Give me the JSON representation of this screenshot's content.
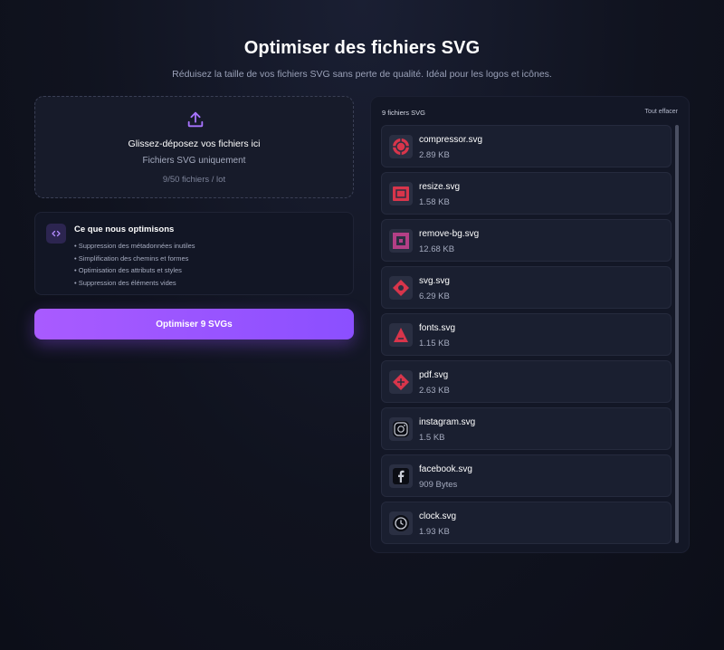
{
  "header": {
    "title": "Optimiser des fichiers SVG",
    "subtitle": "Réduisez la taille de vos fichiers SVG sans perte de qualité. Idéal pour les logos et icônes."
  },
  "dropzone": {
    "icon": "upload-icon",
    "title": "Glissez-déposez vos fichiers ici",
    "subtitle": "Fichiers SVG uniquement",
    "count": "9/50 fichiers / lot"
  },
  "info": {
    "icon": "code-icon",
    "title": "Ce que nous optimisons",
    "items": [
      "• Suppression des métadonnées inutiles",
      "• Simplification des chemins et formes",
      "• Optimisation des attributs et styles",
      "• Suppression des éléments vides"
    ]
  },
  "optimize_button": "Optimiser 9 SVGs",
  "files_panel": {
    "count_label": "9 fichiers SVG",
    "clear_label": "Tout effacer",
    "files": [
      {
        "name": "compressor.svg",
        "size": "2.89 KB",
        "icon": "compressor-icon"
      },
      {
        "name": "resize.svg",
        "size": "1.58 KB",
        "icon": "resize-icon"
      },
      {
        "name": "remove-bg.svg",
        "size": "12.68 KB",
        "icon": "remove-bg-icon"
      },
      {
        "name": "svg.svg",
        "size": "6.29 KB",
        "icon": "svg-icon"
      },
      {
        "name": "fonts.svg",
        "size": "1.15 KB",
        "icon": "fonts-icon"
      },
      {
        "name": "pdf.svg",
        "size": "2.63 KB",
        "icon": "pdf-icon"
      },
      {
        "name": "instagram.svg",
        "size": "1.5 KB",
        "icon": "instagram-icon"
      },
      {
        "name": "facebook.svg",
        "size": "909 Bytes",
        "icon": "facebook-icon"
      },
      {
        "name": "clock.svg",
        "size": "1.93 KB",
        "icon": "clock-icon"
      }
    ]
  },
  "colors": {
    "accent": "#9b57ff",
    "thumb_red": "#d8354b",
    "background": "#10131f"
  }
}
